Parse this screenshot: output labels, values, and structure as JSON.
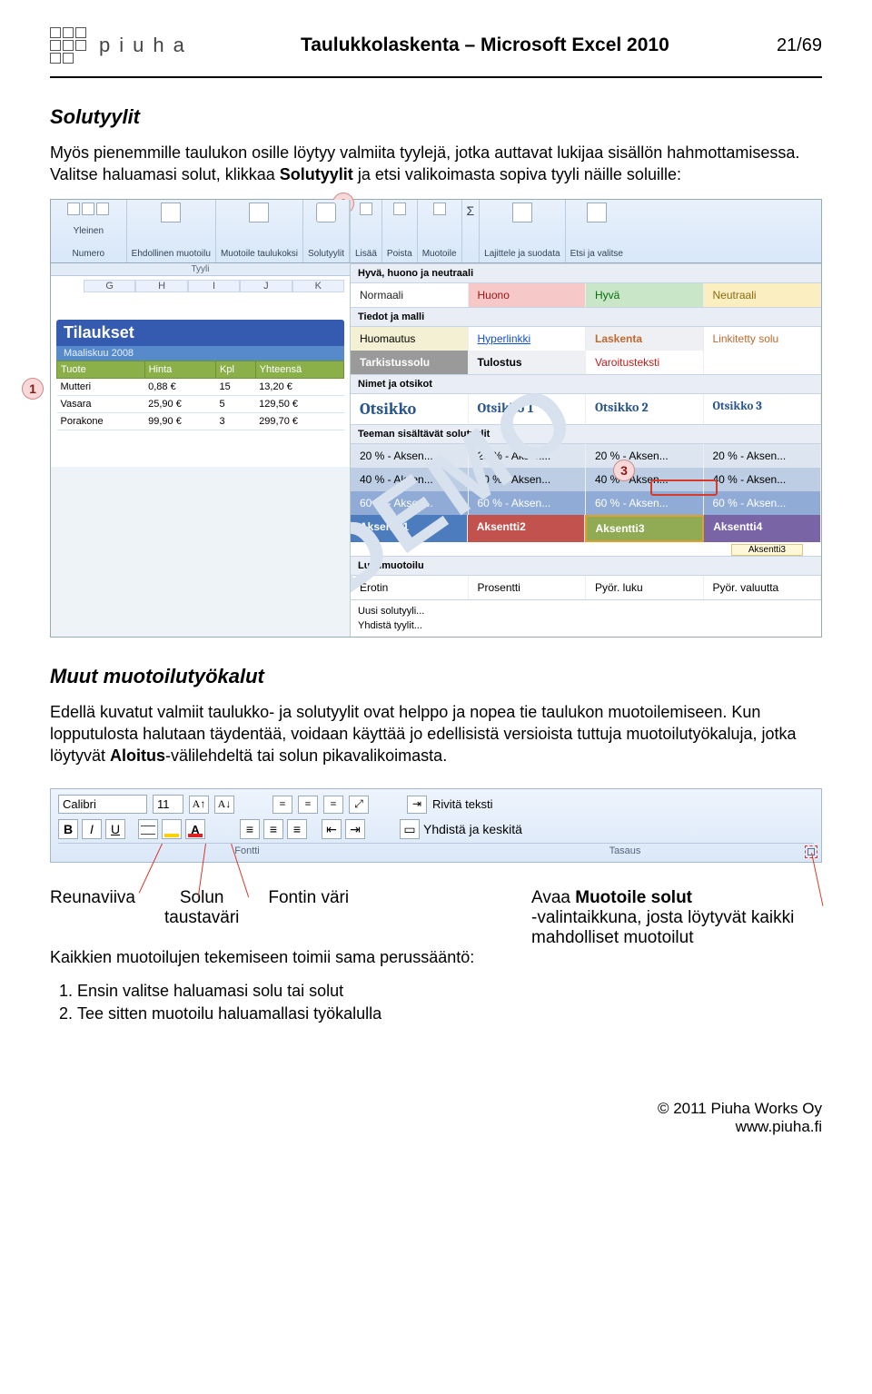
{
  "header": {
    "brand_letters": "piuha",
    "title": "Taulukkolaskenta – Microsoft Excel 2010",
    "page": "21/69"
  },
  "section1": {
    "title": "Solutyylit",
    "p1a": "Myös pienemmille taulukon osille löytyy valmiita tyylejä, jotka auttavat lukijaa sisällön hahmottamisessa. Valitse haluamasi solut, klikkaa ",
    "p1b": "Solutyylit",
    "p1c": " ja etsi valikoimasta sopiva tyyli näille soluille:"
  },
  "ribbon": {
    "groups": {
      "yleinen": "Yleinen",
      "numero": "Numero",
      "ehdollinen": "Ehdollinen\nmuotoilu",
      "muotoile": "Muotoile\ntaulukoksi",
      "solutyylit": "Solutyylit",
      "tyyli": "Tyyli",
      "lisaa": "Lisää",
      "poista": "Poista",
      "muotoile2": "Muotoile",
      "sigma": "Σ",
      "lajittele": "Lajittele ja\nsuodata",
      "etsi": "Etsi ja\nvalitse"
    }
  },
  "sheet": {
    "cols": [
      "G",
      "H",
      "I",
      "J",
      "K"
    ],
    "title": "Tilaukset",
    "subtitle": "Maaliskuu 2008",
    "headers": [
      "Tuote",
      "Hinta",
      "Kpl",
      "Yhteensä"
    ],
    "rows": [
      [
        "Mutteri",
        "0,88 €",
        "15",
        "13,20 €"
      ],
      [
        "Vasara",
        "25,90 €",
        "5",
        "129,50 €"
      ],
      [
        "Porakone",
        "99,90 €",
        "3",
        "299,70 €"
      ]
    ]
  },
  "gallery": {
    "g1": "Hyvä, huono ja neutraali",
    "r1": [
      "Normaali",
      "Huono",
      "Hyvä",
      "Neutraali"
    ],
    "g2": "Tiedot ja malli",
    "r2": [
      "Huomautus",
      "Hyperlinkki",
      "Laskenta",
      "Linkitetty solu"
    ],
    "r3": [
      "Tarkistussolu",
      "Tulostus",
      "Varoitusteksti",
      ""
    ],
    "g3": "Nimet ja otsikot",
    "r4": [
      "Otsikko",
      "Otsikko 1",
      "Otsikko 2",
      "Otsikko 3"
    ],
    "g4": "Teeman sisältävät solutyylit",
    "r5": [
      "20 % - Aksen...",
      "20 % - Aksen...",
      "20 % - Aksen...",
      "20 % - Aksen..."
    ],
    "r6": [
      "40 % - Aksen...",
      "40 % - Aksen...",
      "40 % - Aksen...",
      "40 % - Aksen..."
    ],
    "r7": [
      "60 % - Aksen...",
      "60 % - Aksen...",
      "60 % - Aksen...",
      "60 % - Aksen..."
    ],
    "r8": [
      "Aksentti1",
      "Aksentti2",
      "Aksentti3",
      "Aksentti4"
    ],
    "tooltip": "Aksentti3",
    "g5": "Lukumuotoilu",
    "r9": [
      "Erotin",
      "Prosentti",
      "Pyör. luku",
      "Pyör. valuutta"
    ],
    "m1": "Uusi solutyyli...",
    "m2": "Yhdistä tyylit..."
  },
  "callouts": {
    "n1": "1",
    "n2": "2",
    "n3": "3"
  },
  "watermark": "DEMO",
  "section2": {
    "title": "Muut muotoilutyökalut",
    "p1a": "Edellä kuvatut valmiit taulukko- ja solutyylit ovat helppo ja nopea tie taulukon muotoilemiseen. Kun lopputulosta halutaan täydentää, voidaan käyttää jo edellisistä versioista tuttuja muotoilutyökaluja, jotka löytyvät ",
    "p1b": "Aloitus",
    "p1c": "-välilehdeltä tai solun pikavalikoimasta."
  },
  "fontribbon": {
    "fontname": "Calibri",
    "fontsize": "11",
    "wrap": "Rivitä teksti",
    "merge": "Yhdistä ja keskitä",
    "sec_font": "Fontti",
    "sec_align": "Tasaus",
    "A_label": "A"
  },
  "anno": {
    "reuna": "Reunaviiva",
    "tausta": "Solun\ntaustaväri",
    "fontti": "Fontin väri",
    "rule_intro": "Kaikkien muotoilujen tekemiseen toimii sama perussääntö:",
    "rule1": "Ensin valitse haluamasi solu tai solut",
    "rule2": "Tee sitten muotoilu haluamallasi työkalulla",
    "right1": "Avaa ",
    "right1b": "Muotoile solut",
    "right2": "-valintaikkuna, josta löytyvät kaikki mahdolliset muotoilut"
  },
  "footer": {
    "line1": "© 2011 Piuha Works Oy",
    "line2": "www.piuha.fi"
  }
}
